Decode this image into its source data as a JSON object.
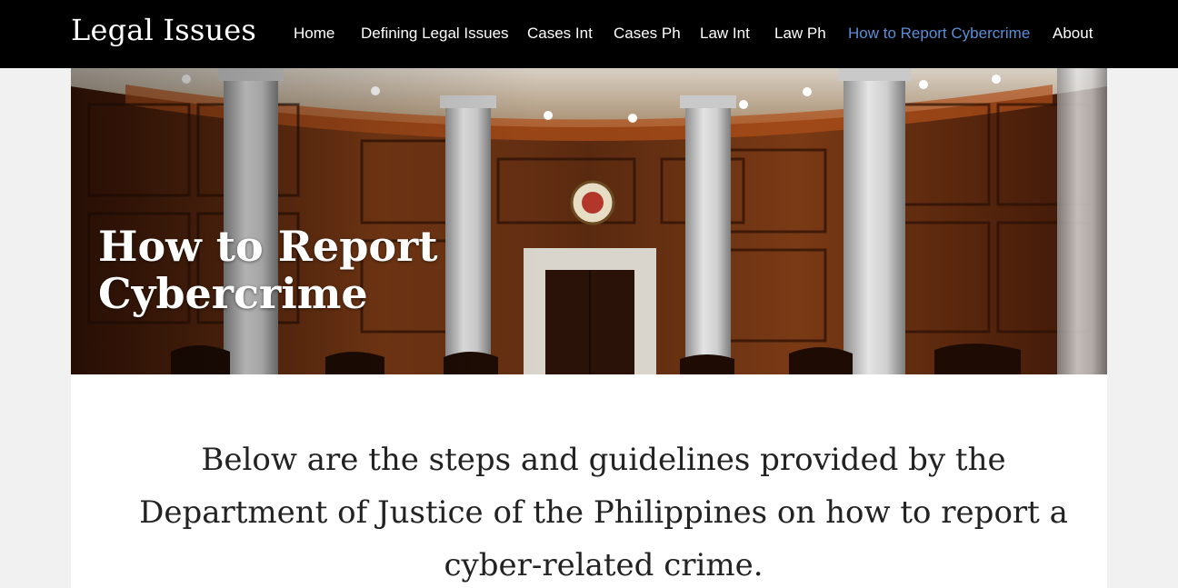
{
  "site": {
    "title": "Legal Issues"
  },
  "nav": {
    "items": [
      {
        "label": "Home",
        "active": false
      },
      {
        "label": "Defining Legal Issues",
        "active": false
      },
      {
        "label": "Cases Int",
        "active": false
      },
      {
        "label": "Cases Ph",
        "active": false
      },
      {
        "label": "Law Int",
        "active": false
      },
      {
        "label": "Law Ph",
        "active": false
      },
      {
        "label": "How to Report Cybercrime",
        "active": true
      },
      {
        "label": "About",
        "active": false
      }
    ]
  },
  "hero": {
    "title": "How to Report Cybercrime",
    "image": "courtroom-photo"
  },
  "main": {
    "intro": "Below are the steps and guidelines provided by the Department of Justice of the Philippines on how to report a cyber-related crime."
  },
  "colors": {
    "topbar": "#000000",
    "nav_active": "#5b8fd6",
    "page_bg": "#f1f1f1"
  }
}
